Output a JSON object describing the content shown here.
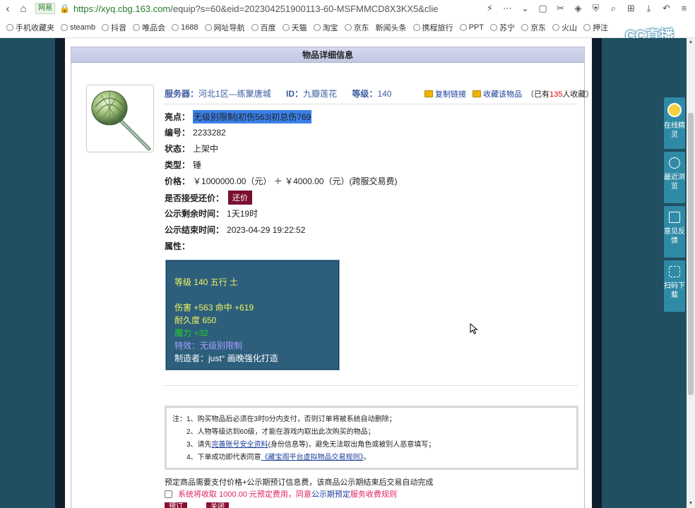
{
  "browser": {
    "site_tag": "网易",
    "url_scheme": "https://",
    "url_host": "xyq.cbg.163.com",
    "url_path": "/equip?s=60&eid=202304251900113-60-MSFMMCD8X3KX5&clie",
    "bookmarks": [
      "手机收藏夹",
      "steamb",
      "抖音",
      "唯品会",
      "1688",
      "网址导航",
      "百度",
      "天猫",
      "淘宝",
      "京东",
      "新闻头条",
      "携程旅行",
      "PPT",
      "苏宁",
      "京东",
      "火山",
      "押注"
    ],
    "overlay_logo": "CC直播"
  },
  "panel": {
    "title": "物品详细信息"
  },
  "item": {
    "server_label": "服务器：",
    "server_value": "河北1区—练聚唐城",
    "id_label": "ID：",
    "id_value": "九瓣莲花",
    "level_label": "等级：",
    "level_value": "140",
    "copy_link": "复制链接",
    "favorite": "收藏该物品",
    "fav_prefix": "（已有",
    "fav_count": "135",
    "fav_suffix": "人收藏）",
    "highlight_label": "亮点：",
    "highlight_value": "无级别限制|初伤563|初总伤769",
    "serial_label": "编号：",
    "serial_value": "2233282",
    "status_label": "状态：",
    "status_value": "上架中",
    "type_label": "类型：",
    "type_value": "锤",
    "price_label": "价格：",
    "price_value": "￥1000000.00（元） ＋ ￥4000.00（元）(跨服交易费)",
    "haggle_label": "是否接受还价：",
    "haggle_button": "还价",
    "remain_label": "公示剩余时间：",
    "remain_value": "1天19时",
    "end_label": "公示结束时间：",
    "end_value": "2023-04-29 19:22:52",
    "attr_label": "属性："
  },
  "attributes": {
    "line1": "等级 140 五行 土",
    "line2": "伤害 +563 命中 +619",
    "line3": "耐久度 650",
    "line4": "魔力 +32",
    "line5": "特效：无级别限制",
    "line6": "制造者：just° 画晚强化打造"
  },
  "notice": {
    "n1": "注：1、购买物品后必须在3时0分内支付，否则订单将被系统自动删除；",
    "n2": "2、人物等级达到60级，才能在游戏内取出此次购买的物品；",
    "n3a": "3、请先",
    "n3link": "完善账号安全资料",
    "n3b": "(身份信息等)，避免无法取出角色或被别人恶意填写；",
    "n4a": "4、下单成功即代表同意",
    "n4link": "《藏宝阁平台虚拟物品交易规则》",
    "n4b": "。"
  },
  "order": {
    "pre_text": "预定商品需要支付价格+公示期预订信息费，该商品公示期结束后交易自动完成",
    "agree_text_a": "系统将收取 1000.00 元预定费用，同意",
    "agree_link": "公示期预定",
    "agree_text_b": "服务收费规则",
    "btn1": "预订",
    "btn2": "关闭"
  },
  "float_bar": [
    "在线精灵",
    "最近浏览",
    "意见反馈",
    "扫码下载"
  ],
  "colors": {
    "price": "#e0245e",
    "highlight_bg": "#3a80e8",
    "attr_bg": "#2d5f7d",
    "button": "#8b1133"
  }
}
